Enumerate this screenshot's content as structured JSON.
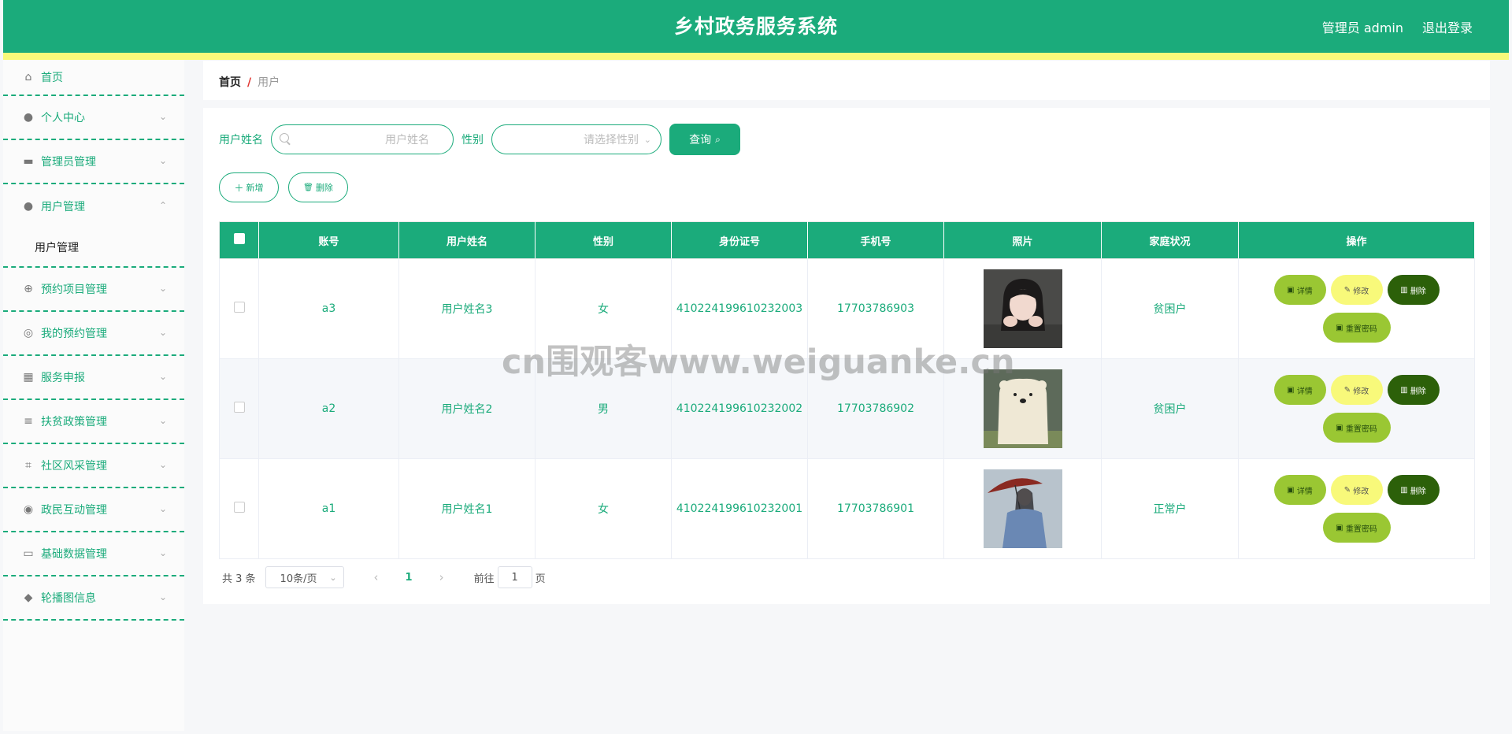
{
  "header": {
    "title": "乡村政务服务系统",
    "user": "管理员 admin",
    "logout": "退出登录"
  },
  "sidebar": {
    "items": [
      {
        "label": "首页",
        "icon": "home-icon"
      },
      {
        "label": "个人中心",
        "icon": "user-icon"
      },
      {
        "label": "管理员管理",
        "icon": "briefcase-icon"
      },
      {
        "label": "用户管理",
        "icon": "user-icon",
        "open": true,
        "sub": "用户管理"
      },
      {
        "label": "预约项目管理",
        "icon": "target-icon"
      },
      {
        "label": "我的预约管理",
        "icon": "compass-icon"
      },
      {
        "label": "服务申报",
        "icon": "grid-icon"
      },
      {
        "label": "扶贫政策管理",
        "icon": "list-icon"
      },
      {
        "label": "社区风采管理",
        "icon": "crop-icon"
      },
      {
        "label": "政民互动管理",
        "icon": "circle-icon"
      },
      {
        "label": "基础数据管理",
        "icon": "card-icon"
      },
      {
        "label": "轮播图信息",
        "icon": "pin-icon"
      }
    ]
  },
  "breadcrumb": {
    "home": "首页",
    "sep": "/",
    "current": "用户"
  },
  "search": {
    "name_label": "用户姓名",
    "name_placeholder": "用户姓名",
    "gender_label": "性别",
    "gender_placeholder": "请选择性别",
    "query_label": "查询"
  },
  "actions": {
    "add": "新增",
    "delete": "删除"
  },
  "table": {
    "headers": [
      "账号",
      "用户姓名",
      "性别",
      "身份证号",
      "手机号",
      "照片",
      "家庭状况",
      "操作"
    ],
    "rows": [
      {
        "account": "a3",
        "name": "用户姓名3",
        "gender": "女",
        "id_no": "410224199610232003",
        "phone": "17703786903",
        "family": "贫困户"
      },
      {
        "account": "a2",
        "name": "用户姓名2",
        "gender": "男",
        "id_no": "410224199610232002",
        "phone": "17703786902",
        "family": "贫困户"
      },
      {
        "account": "a1",
        "name": "用户姓名1",
        "gender": "女",
        "id_no": "410224199610232001",
        "phone": "17703786901",
        "family": "正常户"
      }
    ],
    "ops": {
      "detail": "详情",
      "edit": "修改",
      "delete": "删除",
      "reset": "重置密码"
    }
  },
  "pager": {
    "total": "共 3 条",
    "size": "10条/页",
    "page": "1",
    "goto_prefix": "前往",
    "goto_value": "1",
    "goto_suffix": "页"
  },
  "watermark": "cn围观客www.weiguanke.cn",
  "colors": {
    "primary": "#1bab7b",
    "accent_yellow": "#f8f97a",
    "detail_green": "#9ac733",
    "delete_dark": "#2c6009"
  }
}
